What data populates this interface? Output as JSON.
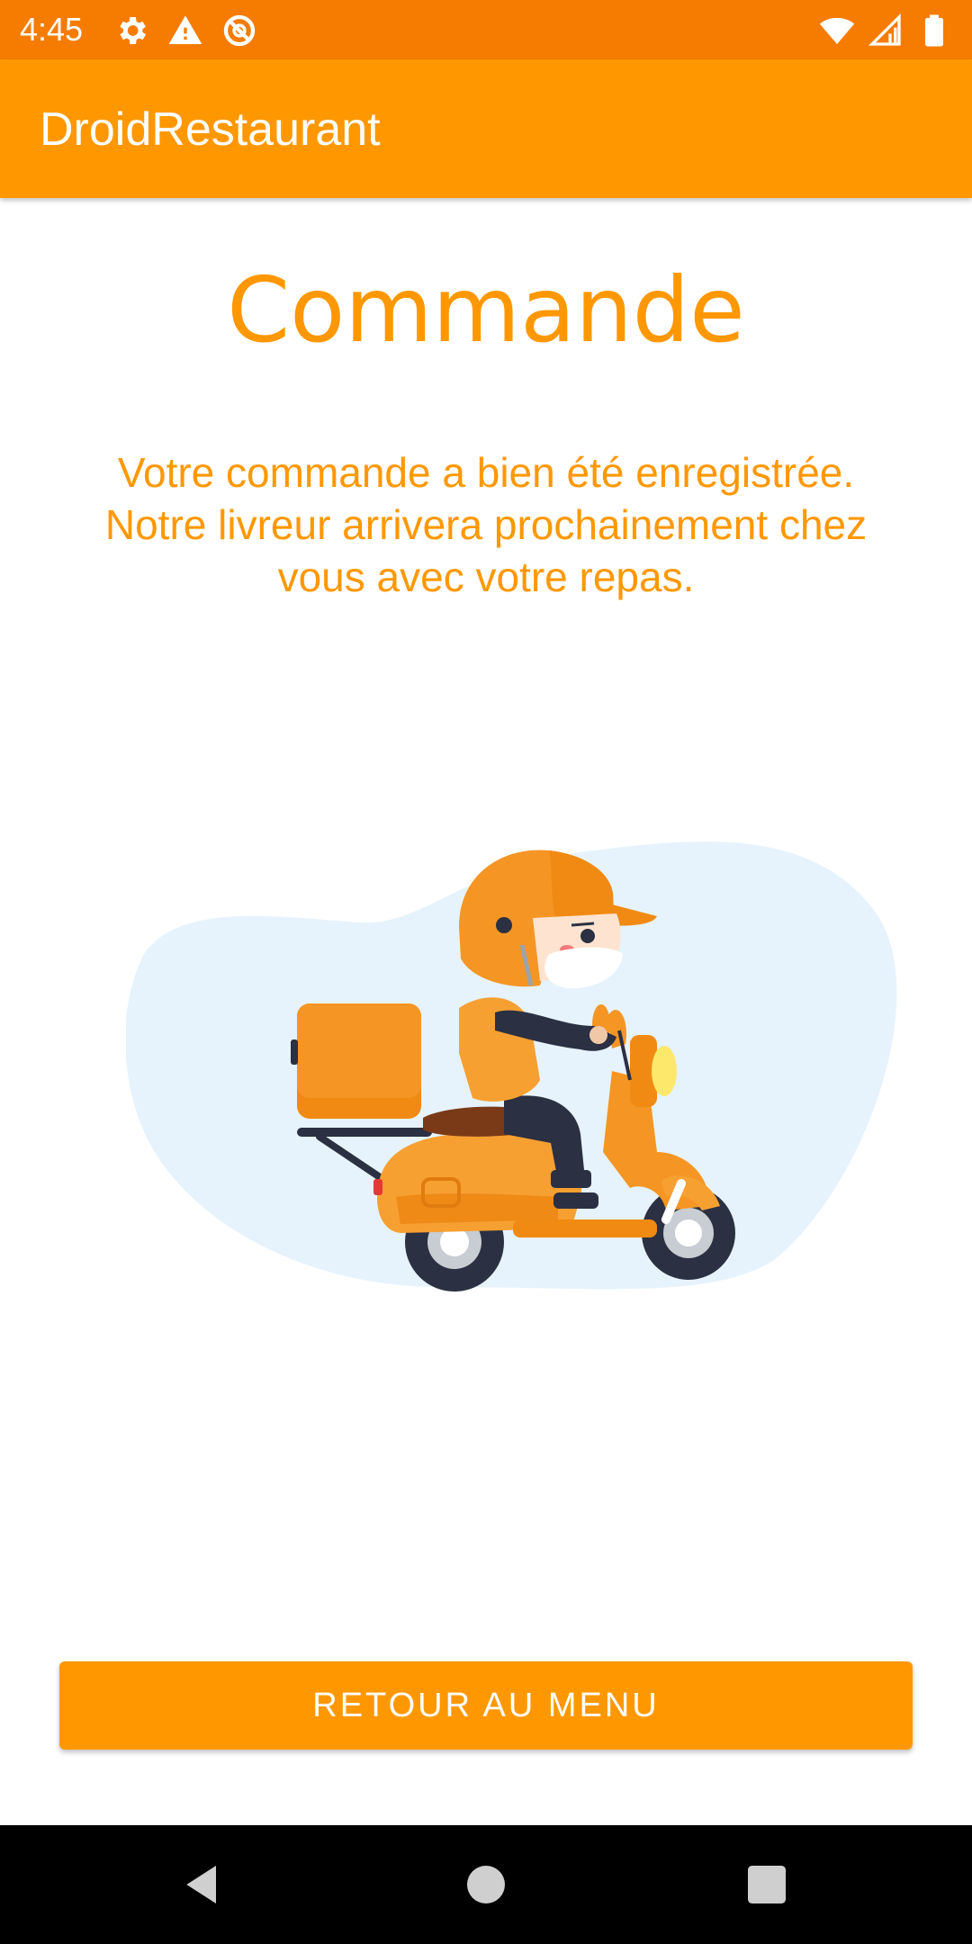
{
  "status_bar": {
    "time": "4:45",
    "left_icons": [
      "gear-icon",
      "warning-icon",
      "do-not-disturb-icon"
    ],
    "right_icons": [
      "wifi-icon",
      "signal-icon",
      "battery-icon"
    ],
    "color": "#f57c00"
  },
  "app_bar": {
    "title": "DroidRestaurant",
    "color": "#ff9800"
  },
  "content": {
    "title": "Commande",
    "message_line1": "Votre commande a bien été enregistrée.",
    "message_line2": "Notre livreur arrivera prochainement chez",
    "message_line3": "vous avec votre repas.",
    "illustration": "delivery-scooter-illustration"
  },
  "actions": {
    "back_to_menu": "RETOUR AU MENU"
  },
  "nav_bar": {
    "buttons": [
      "back-icon",
      "home-icon",
      "recents-icon"
    ]
  },
  "colors": {
    "accent": "#ff9800",
    "status": "#f57c00",
    "background": "#ffffff"
  }
}
